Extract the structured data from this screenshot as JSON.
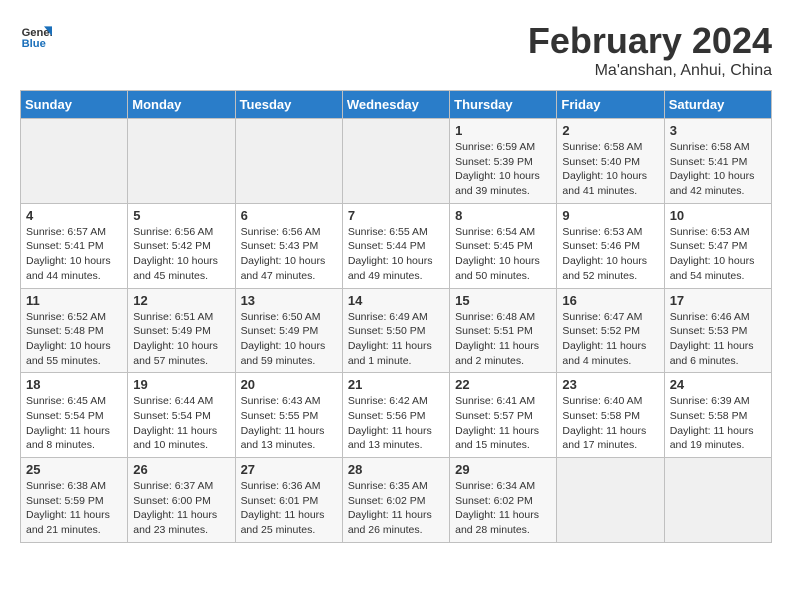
{
  "header": {
    "logo_line1": "General",
    "logo_line2": "Blue",
    "month": "February 2024",
    "location": "Ma'anshan, Anhui, China"
  },
  "weekdays": [
    "Sunday",
    "Monday",
    "Tuesday",
    "Wednesday",
    "Thursday",
    "Friday",
    "Saturday"
  ],
  "weeks": [
    [
      {
        "day": "",
        "info": ""
      },
      {
        "day": "",
        "info": ""
      },
      {
        "day": "",
        "info": ""
      },
      {
        "day": "",
        "info": ""
      },
      {
        "day": "1",
        "info": "Sunrise: 6:59 AM\nSunset: 5:39 PM\nDaylight: 10 hours\nand 39 minutes."
      },
      {
        "day": "2",
        "info": "Sunrise: 6:58 AM\nSunset: 5:40 PM\nDaylight: 10 hours\nand 41 minutes."
      },
      {
        "day": "3",
        "info": "Sunrise: 6:58 AM\nSunset: 5:41 PM\nDaylight: 10 hours\nand 42 minutes."
      }
    ],
    [
      {
        "day": "4",
        "info": "Sunrise: 6:57 AM\nSunset: 5:41 PM\nDaylight: 10 hours\nand 44 minutes."
      },
      {
        "day": "5",
        "info": "Sunrise: 6:56 AM\nSunset: 5:42 PM\nDaylight: 10 hours\nand 45 minutes."
      },
      {
        "day": "6",
        "info": "Sunrise: 6:56 AM\nSunset: 5:43 PM\nDaylight: 10 hours\nand 47 minutes."
      },
      {
        "day": "7",
        "info": "Sunrise: 6:55 AM\nSunset: 5:44 PM\nDaylight: 10 hours\nand 49 minutes."
      },
      {
        "day": "8",
        "info": "Sunrise: 6:54 AM\nSunset: 5:45 PM\nDaylight: 10 hours\nand 50 minutes."
      },
      {
        "day": "9",
        "info": "Sunrise: 6:53 AM\nSunset: 5:46 PM\nDaylight: 10 hours\nand 52 minutes."
      },
      {
        "day": "10",
        "info": "Sunrise: 6:53 AM\nSunset: 5:47 PM\nDaylight: 10 hours\nand 54 minutes."
      }
    ],
    [
      {
        "day": "11",
        "info": "Sunrise: 6:52 AM\nSunset: 5:48 PM\nDaylight: 10 hours\nand 55 minutes."
      },
      {
        "day": "12",
        "info": "Sunrise: 6:51 AM\nSunset: 5:49 PM\nDaylight: 10 hours\nand 57 minutes."
      },
      {
        "day": "13",
        "info": "Sunrise: 6:50 AM\nSunset: 5:49 PM\nDaylight: 10 hours\nand 59 minutes."
      },
      {
        "day": "14",
        "info": "Sunrise: 6:49 AM\nSunset: 5:50 PM\nDaylight: 11 hours\nand 1 minute."
      },
      {
        "day": "15",
        "info": "Sunrise: 6:48 AM\nSunset: 5:51 PM\nDaylight: 11 hours\nand 2 minutes."
      },
      {
        "day": "16",
        "info": "Sunrise: 6:47 AM\nSunset: 5:52 PM\nDaylight: 11 hours\nand 4 minutes."
      },
      {
        "day": "17",
        "info": "Sunrise: 6:46 AM\nSunset: 5:53 PM\nDaylight: 11 hours\nand 6 minutes."
      }
    ],
    [
      {
        "day": "18",
        "info": "Sunrise: 6:45 AM\nSunset: 5:54 PM\nDaylight: 11 hours\nand 8 minutes."
      },
      {
        "day": "19",
        "info": "Sunrise: 6:44 AM\nSunset: 5:54 PM\nDaylight: 11 hours\nand 10 minutes."
      },
      {
        "day": "20",
        "info": "Sunrise: 6:43 AM\nSunset: 5:55 PM\nDaylight: 11 hours\nand 13 minutes."
      },
      {
        "day": "21",
        "info": "Sunrise: 6:42 AM\nSunset: 5:56 PM\nDaylight: 11 hours\nand 13 minutes."
      },
      {
        "day": "22",
        "info": "Sunrise: 6:41 AM\nSunset: 5:57 PM\nDaylight: 11 hours\nand 15 minutes."
      },
      {
        "day": "23",
        "info": "Sunrise: 6:40 AM\nSunset: 5:58 PM\nDaylight: 11 hours\nand 17 minutes."
      },
      {
        "day": "24",
        "info": "Sunrise: 6:39 AM\nSunset: 5:58 PM\nDaylight: 11 hours\nand 19 minutes."
      }
    ],
    [
      {
        "day": "25",
        "info": "Sunrise: 6:38 AM\nSunset: 5:59 PM\nDaylight: 11 hours\nand 21 minutes."
      },
      {
        "day": "26",
        "info": "Sunrise: 6:37 AM\nSunset: 6:00 PM\nDaylight: 11 hours\nand 23 minutes."
      },
      {
        "day": "27",
        "info": "Sunrise: 6:36 AM\nSunset: 6:01 PM\nDaylight: 11 hours\nand 25 minutes."
      },
      {
        "day": "28",
        "info": "Sunrise: 6:35 AM\nSunset: 6:02 PM\nDaylight: 11 hours\nand 26 minutes."
      },
      {
        "day": "29",
        "info": "Sunrise: 6:34 AM\nSunset: 6:02 PM\nDaylight: 11 hours\nand 28 minutes."
      },
      {
        "day": "",
        "info": ""
      },
      {
        "day": "",
        "info": ""
      }
    ]
  ]
}
